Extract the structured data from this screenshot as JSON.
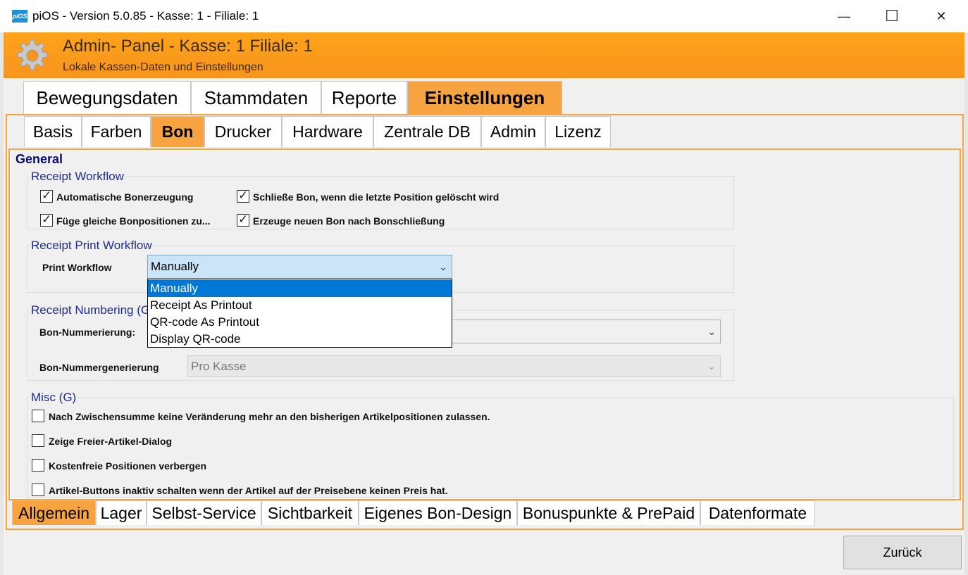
{
  "window": {
    "app_icon_label": "piOS",
    "title": "piOS -  Version 5.0.85 - Kasse: 1 - Filiale: 1",
    "minimize_glyph": "—",
    "maximize_glyph": "☐",
    "close_glyph": "✕"
  },
  "header": {
    "title": "Admin- Panel - Kasse: 1 Filiale: 1",
    "subtitle": "Lokale Kassen-Daten und Einstellungen",
    "background_color": "#f7941d"
  },
  "main_tabs": [
    {
      "label": "Bewegungsdaten",
      "active": false
    },
    {
      "label": "Stammdaten",
      "active": false
    },
    {
      "label": "Reporte",
      "active": false
    },
    {
      "label": "Einstellungen",
      "active": true
    }
  ],
  "sub_tabs": [
    {
      "label": "Basis",
      "active": false
    },
    {
      "label": "Farben",
      "active": false
    },
    {
      "label": "Bon",
      "active": true
    },
    {
      "label": "Drucker",
      "active": false
    },
    {
      "label": "Hardware",
      "active": false
    },
    {
      "label": "Zentrale DB",
      "active": false
    },
    {
      "label": "Admin",
      "active": false
    },
    {
      "label": "Lizenz",
      "active": false
    }
  ],
  "content": {
    "section_title": "General",
    "receipt_workflow": {
      "title": "Receipt Workflow",
      "checkboxes": [
        {
          "label": "Automatische Bonerzeugung",
          "checked": true
        },
        {
          "label": "Schließe Bon, wenn die letzte Position gelöscht wird",
          "checked": true
        },
        {
          "label": "Füge gleiche Bonpositionen zu...",
          "checked": true
        },
        {
          "label": "Erzeuge neuen Bon nach Bonschließung",
          "checked": true
        }
      ]
    },
    "receipt_print_workflow": {
      "title": "Receipt Print Workflow",
      "field_label": "Print Workflow",
      "selected_value": "Manually",
      "options": [
        "Manually",
        "Receipt As Printout",
        "QR-code As Printout",
        "Display QR-code"
      ],
      "highlighted_option": "Manually"
    },
    "receipt_numbering": {
      "title": "Receipt Numbering (G",
      "numbering_label": "Bon-Nummerierung:",
      "numbering_value": "",
      "generation_label": "Bon-Nummergenerierung",
      "generation_value": "Pro Kasse"
    },
    "misc": {
      "title": "Misc (G)",
      "checkboxes": [
        {
          "label": "Nach Zwischensumme keine Veränderung mehr an den bisherigen Artikelpositionen zulassen.",
          "checked": false
        },
        {
          "label": "Zeige Freier-Artikel-Dialog",
          "checked": false
        },
        {
          "label": "Kostenfreie Positionen verbergen",
          "checked": false
        },
        {
          "label": "Artikel-Buttons inaktiv schalten wenn der Artikel auf der Preisebene keinen Preis hat.",
          "checked": false
        }
      ]
    }
  },
  "bottom_tabs": [
    {
      "label": "Allgemein",
      "active": true
    },
    {
      "label": "Lager",
      "active": false
    },
    {
      "label": "Selbst-Service",
      "active": false
    },
    {
      "label": "Sichtbarkeit",
      "active": false
    },
    {
      "label": "Eigenes Bon-Design",
      "active": false
    },
    {
      "label": "Bonuspunkte & PrePaid",
      "active": false
    },
    {
      "label": "Datenformate",
      "active": false
    }
  ],
  "back_button_label": "Zurück",
  "accent_color": "#f7a440",
  "selection_color": "#0078d7"
}
